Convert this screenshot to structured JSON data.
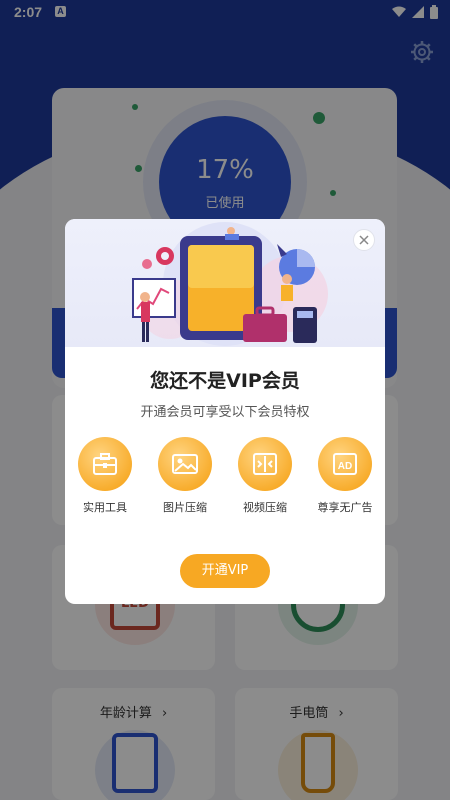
{
  "status_bar": {
    "time": "2:07",
    "notification_letter": "A"
  },
  "storage": {
    "percent": "17%",
    "used_label": "已使用"
  },
  "tiles": {
    "age_calc": {
      "label": "年龄计算"
    },
    "flashlight": {
      "label": "手电筒"
    },
    "led_text": "LED"
  },
  "modal": {
    "title": "您还不是VIP会员",
    "subtitle": "开通会员可享受以下会员特权",
    "features": [
      {
        "label": "实用工具",
        "icon": "toolbox-icon"
      },
      {
        "label": "图片压缩",
        "icon": "image-icon"
      },
      {
        "label": "视频压缩",
        "icon": "compress-icon"
      },
      {
        "label": "尊享无广告",
        "icon": "no-ad-icon"
      }
    ],
    "button": "开通VIP"
  },
  "colors": {
    "header_blue": "#1e3a9c",
    "accent_orange": "#f7a823",
    "ring_blue": "#2e55cf"
  }
}
